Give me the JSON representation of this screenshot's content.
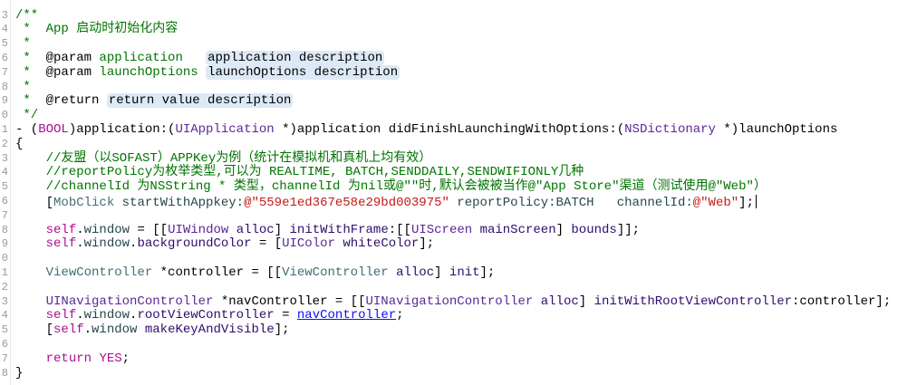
{
  "editor": {
    "lines": [
      {
        "num": "3",
        "tokens": [
          [
            "/**",
            "c"
          ]
        ]
      },
      {
        "num": "4",
        "tokens": [
          [
            " *  App 启动时初始化内容",
            "c"
          ]
        ]
      },
      {
        "num": "5",
        "tokens": [
          [
            " *",
            "c"
          ]
        ]
      },
      {
        "num": "6",
        "tokens": [
          [
            " *  ",
            "c"
          ],
          [
            "@param",
            "n"
          ],
          [
            " application   ",
            "c"
          ],
          [
            "application description",
            "d"
          ]
        ]
      },
      {
        "num": "7",
        "tokens": [
          [
            " *  ",
            "c"
          ],
          [
            "@param",
            "n"
          ],
          [
            " launchOptions ",
            "c"
          ],
          [
            "launchOptions description",
            "d"
          ]
        ]
      },
      {
        "num": "8",
        "tokens": [
          [
            " *",
            "c"
          ]
        ]
      },
      {
        "num": "9",
        "tokens": [
          [
            " *  ",
            "c"
          ],
          [
            "@return",
            "n"
          ],
          [
            " ",
            "c"
          ],
          [
            "return value description",
            "d"
          ]
        ]
      },
      {
        "num": "0",
        "tokens": [
          [
            " */",
            "c"
          ]
        ]
      },
      {
        "num": "1",
        "tokens": [
          [
            "- (",
            "n"
          ],
          [
            "BOOL",
            "k"
          ],
          [
            ")application:(",
            "n"
          ],
          [
            "UIApplication",
            "t"
          ],
          [
            " *)application didFinishLaunchingWithOptions:(",
            "n"
          ],
          [
            "NSDictionary",
            "t"
          ],
          [
            " *)launchOptions",
            "n"
          ]
        ]
      },
      {
        "num": "2",
        "tokens": [
          [
            "{",
            "n"
          ]
        ]
      },
      {
        "num": "3",
        "tokens": [
          [
            "    //友盟（以SOFAST）APPKey为例（统计在模拟机和真机上均有效）",
            "c"
          ]
        ]
      },
      {
        "num": "4",
        "tokens": [
          [
            "    //reportPolicy为枚举类型,可以为 REALTIME, BATCH,SENDDAILY,SENDWIFIONLY几种",
            "c"
          ]
        ]
      },
      {
        "num": "5",
        "tokens": [
          [
            "    //channelId 为NSString * 类型，channelId 为nil或@\"\"时,默认会被被当作@\"App Store\"渠道（测试使用@\"Web\"）",
            "c"
          ]
        ]
      },
      {
        "num": "6",
        "tokens": [
          [
            "    [",
            "n"
          ],
          [
            "MobClick",
            "p"
          ],
          [
            " startWithAppkey:",
            "pm"
          ],
          [
            "@\"559e1ed367e58e29bd003975\"",
            "s"
          ],
          [
            " reportPolicy:BATCH   channelId:",
            "pm"
          ],
          [
            "@\"Web\"",
            "s"
          ],
          [
            "];",
            "n"
          ]
        ],
        "cursor": true
      },
      {
        "num": "7",
        "tokens": []
      },
      {
        "num": "8",
        "tokens": [
          [
            "    ",
            "n"
          ],
          [
            "self",
            "k"
          ],
          [
            ".",
            "n"
          ],
          [
            "window",
            "pm"
          ],
          [
            " = [[",
            "n"
          ],
          [
            "UIWindow",
            "t"
          ],
          [
            " ",
            "n"
          ],
          [
            "alloc",
            "m"
          ],
          [
            "] ",
            "n"
          ],
          [
            "initWithFrame",
            "m"
          ],
          [
            ":[[",
            "n"
          ],
          [
            "UIScreen",
            "t"
          ],
          [
            " ",
            "n"
          ],
          [
            "mainScreen",
            "m"
          ],
          [
            "] ",
            "n"
          ],
          [
            "bounds",
            "m"
          ],
          [
            "]];",
            "n"
          ]
        ]
      },
      {
        "num": "9",
        "tokens": [
          [
            "    ",
            "n"
          ],
          [
            "self",
            "k"
          ],
          [
            ".",
            "n"
          ],
          [
            "window",
            "pm"
          ],
          [
            ".",
            "n"
          ],
          [
            "backgroundColor",
            "m"
          ],
          [
            " = [",
            "n"
          ],
          [
            "UIColor",
            "t"
          ],
          [
            " ",
            "n"
          ],
          [
            "whiteColor",
            "m"
          ],
          [
            "];",
            "n"
          ]
        ]
      },
      {
        "num": "0",
        "tokens": []
      },
      {
        "num": "1",
        "tokens": [
          [
            "    ",
            "n"
          ],
          [
            "ViewController",
            "p"
          ],
          [
            " *controller = [[",
            "n"
          ],
          [
            "ViewController",
            "p"
          ],
          [
            " ",
            "n"
          ],
          [
            "alloc",
            "m"
          ],
          [
            "] ",
            "n"
          ],
          [
            "init",
            "m"
          ],
          [
            "];",
            "n"
          ]
        ]
      },
      {
        "num": "2",
        "tokens": []
      },
      {
        "num": "3",
        "tokens": [
          [
            "    ",
            "n"
          ],
          [
            "UINavigationController",
            "t"
          ],
          [
            " *navController = [[",
            "n"
          ],
          [
            "UINavigationController",
            "t"
          ],
          [
            " ",
            "n"
          ],
          [
            "alloc",
            "m"
          ],
          [
            "] ",
            "n"
          ],
          [
            "initWithRootViewController",
            "m"
          ],
          [
            ":controller];",
            "n"
          ]
        ]
      },
      {
        "num": "4",
        "tokens": [
          [
            "    ",
            "n"
          ],
          [
            "self",
            "k"
          ],
          [
            ".",
            "n"
          ],
          [
            "window",
            "pm"
          ],
          [
            ".",
            "n"
          ],
          [
            "rootViewController",
            "m"
          ],
          [
            " = ",
            "n"
          ],
          [
            "navController",
            "l"
          ],
          [
            ";",
            "n"
          ]
        ]
      },
      {
        "num": "5",
        "tokens": [
          [
            "    [",
            "n"
          ],
          [
            "self",
            "k"
          ],
          [
            ".",
            "n"
          ],
          [
            "window",
            "pm"
          ],
          [
            " ",
            "n"
          ],
          [
            "makeKeyAndVisible",
            "m"
          ],
          [
            "];",
            "n"
          ]
        ]
      },
      {
        "num": "6",
        "tokens": []
      },
      {
        "num": "7",
        "tokens": [
          [
            "    ",
            "n"
          ],
          [
            "return",
            "k"
          ],
          [
            " ",
            "n"
          ],
          [
            "YES",
            "k"
          ],
          [
            ";",
            "n"
          ]
        ]
      },
      {
        "num": "8",
        "tokens": [
          [
            "}",
            "n"
          ]
        ]
      }
    ]
  },
  "colors": {
    "comment": "#007400",
    "keyword": "#aa0d91",
    "system_class": "#5c2699",
    "project_class": "#3f6e74",
    "string": "#c41a16",
    "placeholder_bg": "#dde9f6"
  }
}
